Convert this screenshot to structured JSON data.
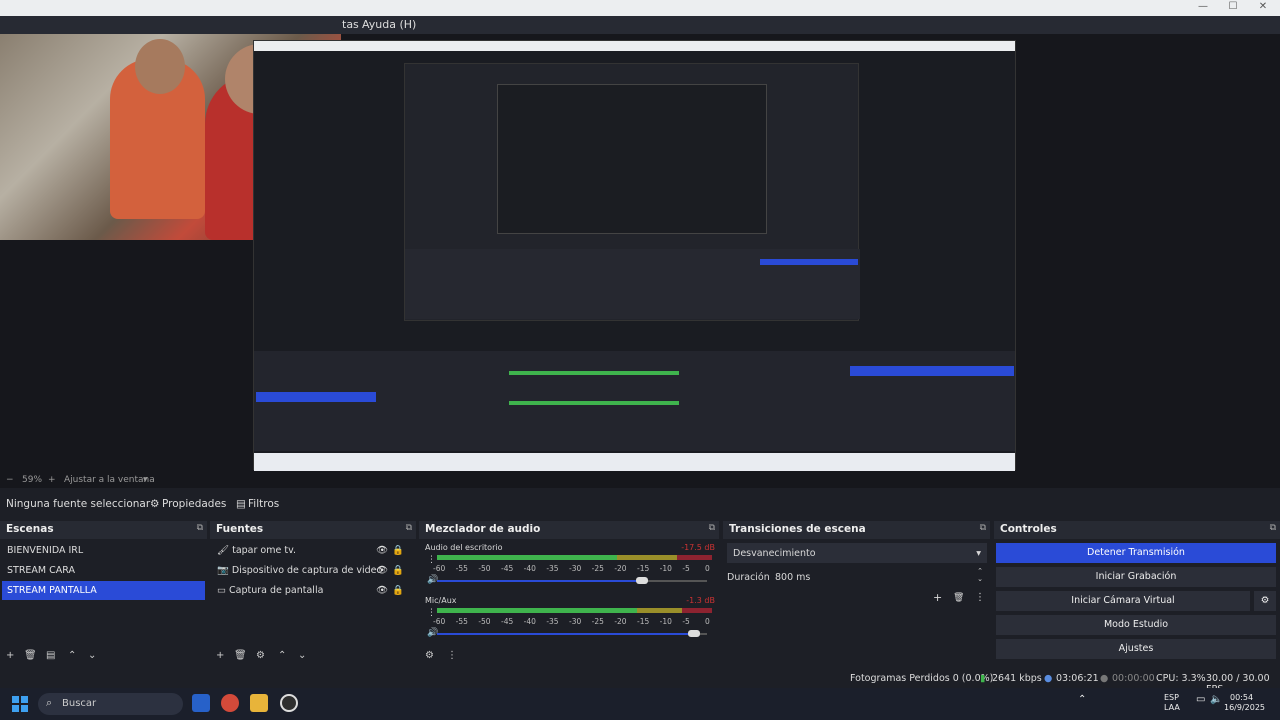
{
  "window": {
    "menu_visible": [
      "tas",
      "Ayuda (H)"
    ]
  },
  "preview": {
    "zoom_label": "59%",
    "fit_label": "Ajustar a la ventana"
  },
  "context": {
    "no_source": "Ninguna fuente seleccionar",
    "properties": "Propiedades",
    "filters": "Filtros"
  },
  "scenes": {
    "title": "Escenas",
    "items": [
      "BIENVENIDA IRL",
      "STREAM CARA",
      "STREAM PANTALLA"
    ],
    "selected": "STREAM PANTALLA"
  },
  "sources": {
    "title": "Fuentes",
    "items": [
      "tapar ome tv.",
      "Dispositivo de captura de video",
      "Captura de pantalla"
    ]
  },
  "mixer": {
    "title": "Mezclador de audio",
    "scale": [
      "-60",
      "-55",
      "-50",
      "-45",
      "-40",
      "-35",
      "-30",
      "-25",
      "-20",
      "-15",
      "-10",
      "-5",
      "0"
    ],
    "channels": [
      {
        "name": "Audio del escritorio",
        "db": "-17.5 dB",
        "volume": 0.76
      },
      {
        "name": "Mic/Aux",
        "db": "-1.3 dB",
        "volume": 0.95
      }
    ]
  },
  "transitions": {
    "title": "Transiciones de escena",
    "selected": "Desvanecimiento",
    "duration_label": "Duración",
    "duration_value": "800 ms"
  },
  "controls": {
    "title": "Controles",
    "buttons": [
      "Detener Transmisión",
      "Iniciar Grabación",
      "Iniciar Cámara Virtual",
      "Modo Estudio",
      "Ajustes"
    ]
  },
  "status": {
    "dropped": "Fotogramas Perdidos 0 (0.0%)",
    "bitrate": "2641 kbps",
    "stream_time": "03:06:21",
    "rec_time": "00:00:00",
    "cpu": "CPU: 3.3%",
    "fps": "30.00 / 30.00 FPS"
  },
  "taskbar": {
    "search_placeholder": "Buscar",
    "lang1": "ESP",
    "lang2": "LAA",
    "time": "00:54",
    "date": "16/9/2025"
  },
  "colors": {
    "accent": "#2a4bd7",
    "bg": "#1d1f26",
    "header": "#272a33"
  }
}
